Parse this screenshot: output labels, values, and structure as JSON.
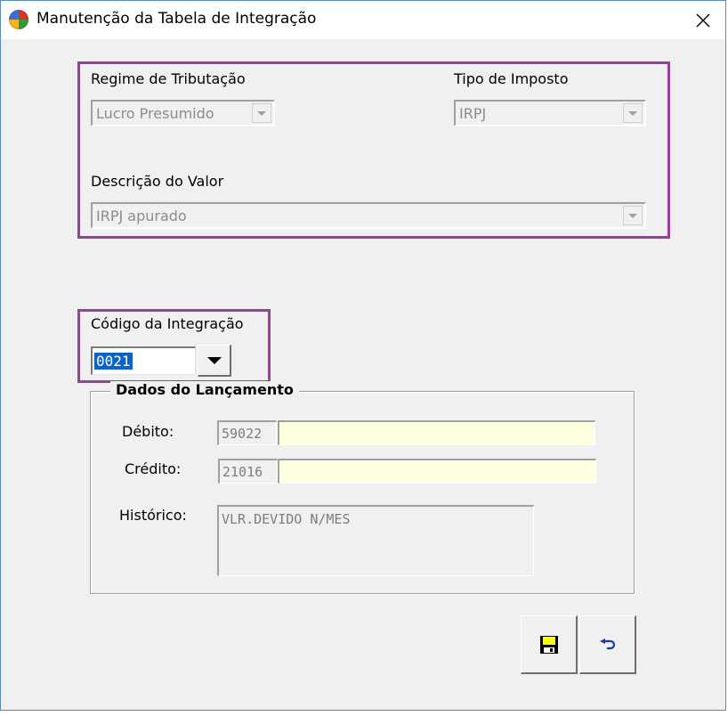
{
  "window": {
    "title": "Manutenção da Tabela de Integração"
  },
  "filters": {
    "regime_label": "Regime de Tributação",
    "regime_value": "Lucro Presumido",
    "tipo_label": "Tipo de Imposto",
    "tipo_value": "IRPJ",
    "descricao_label": "Descrição do Valor",
    "descricao_value": "IRPJ apurado"
  },
  "integracao": {
    "label": "Código da Integração",
    "value": "0021"
  },
  "lancamento": {
    "title": "Dados do Lançamento",
    "debito_label": "Débito:",
    "debito_code": "59022",
    "debito_desc": "",
    "credito_label": "Crédito:",
    "credito_code": "21016",
    "credito_desc": "",
    "historico_label": "Histórico:",
    "historico_value": "VLR.DEVIDO N/MES"
  },
  "icons": {
    "app": "app-logo-icon",
    "close": "close-icon",
    "save": "floppy-disk-icon",
    "undo": "undo-arrow-icon"
  },
  "colors": {
    "highlight": "#9b3f9b",
    "field_yellow": "#ffffe1",
    "selection": "#0a64c8",
    "window_bg": "#f0f0f0"
  }
}
